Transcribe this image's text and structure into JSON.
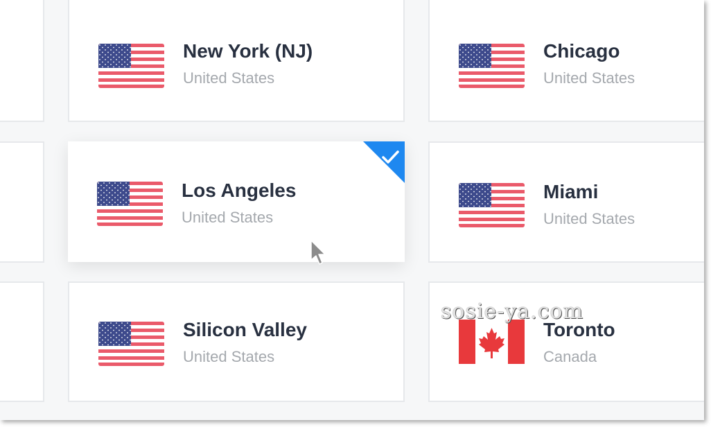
{
  "locations": [
    {
      "city": "New York (NJ)",
      "country": "United States",
      "flag": "us-flag-icon",
      "selected": false
    },
    {
      "city": "Chicago",
      "country": "United States",
      "flag": "us-flag-icon",
      "selected": false
    },
    {
      "city": "Los Angeles",
      "country": "United States",
      "flag": "us-flag-icon",
      "selected": true
    },
    {
      "city": "Miami",
      "country": "United States",
      "flag": "us-flag-icon",
      "selected": false
    },
    {
      "city": "Silicon Valley",
      "country": "United States",
      "flag": "us-flag-icon",
      "selected": false
    },
    {
      "city": "Toronto",
      "country": "Canada",
      "flag": "canada-flag-icon",
      "selected": false
    }
  ],
  "selected_indicator": {
    "icon": "checkmark-icon",
    "color": "#1e88f0"
  },
  "watermark": "sosie-ya.com",
  "colors": {
    "city_text": "#283040",
    "country_text": "#a4a8ad",
    "us_red": "#ea5a6a",
    "us_blue": "#3d4a8c",
    "canada_red": "#e8393c"
  }
}
